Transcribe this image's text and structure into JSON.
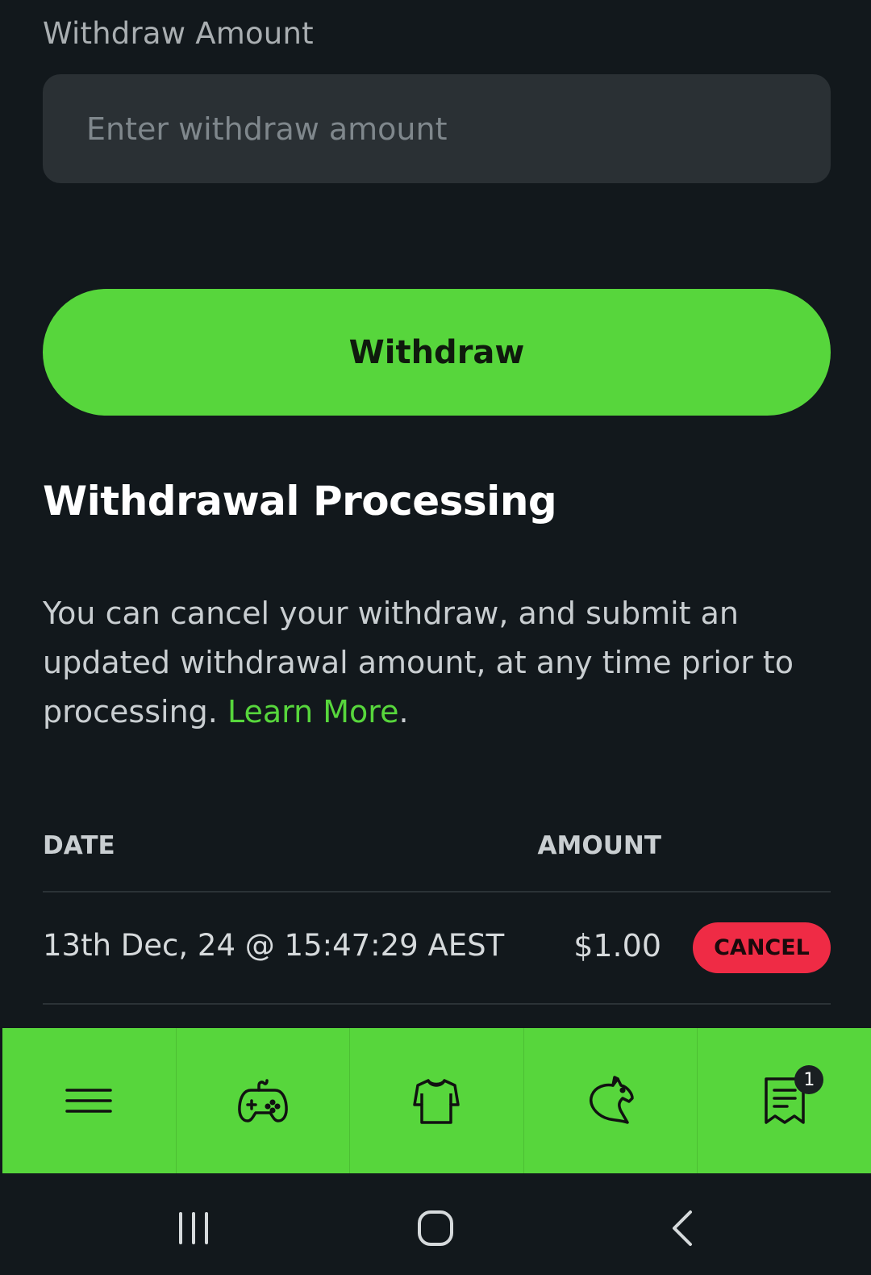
{
  "form": {
    "label": "Withdraw Amount",
    "placeholder": "Enter withdraw amount",
    "value": "",
    "button_label": "Withdraw"
  },
  "processing": {
    "title": "Withdrawal Processing",
    "text_before": "You can cancel your withdraw, and submit an updated withdrawal amount, at any time prior to processing. ",
    "link_label": "Learn More",
    "text_after": "."
  },
  "table": {
    "headers": {
      "date": "DATE",
      "amount": "AMOUNT"
    },
    "rows": [
      {
        "date": "13th Dec, 24 @ 15:47:29 AEST",
        "amount": "$1.00",
        "action": "CANCEL"
      }
    ]
  },
  "bottom_nav": {
    "items": [
      {
        "icon": "menu-icon"
      },
      {
        "icon": "gamepad-icon"
      },
      {
        "icon": "shirt-icon"
      },
      {
        "icon": "horse-icon"
      },
      {
        "icon": "receipt-icon",
        "badge": "1"
      }
    ]
  },
  "system_nav": {
    "items": [
      "recent-apps-icon",
      "home-icon",
      "back-icon"
    ]
  },
  "colors": {
    "background": "#12181c",
    "accent": "#57d63c",
    "danger": "#ef2b45",
    "input_bg": "#2a3034"
  }
}
